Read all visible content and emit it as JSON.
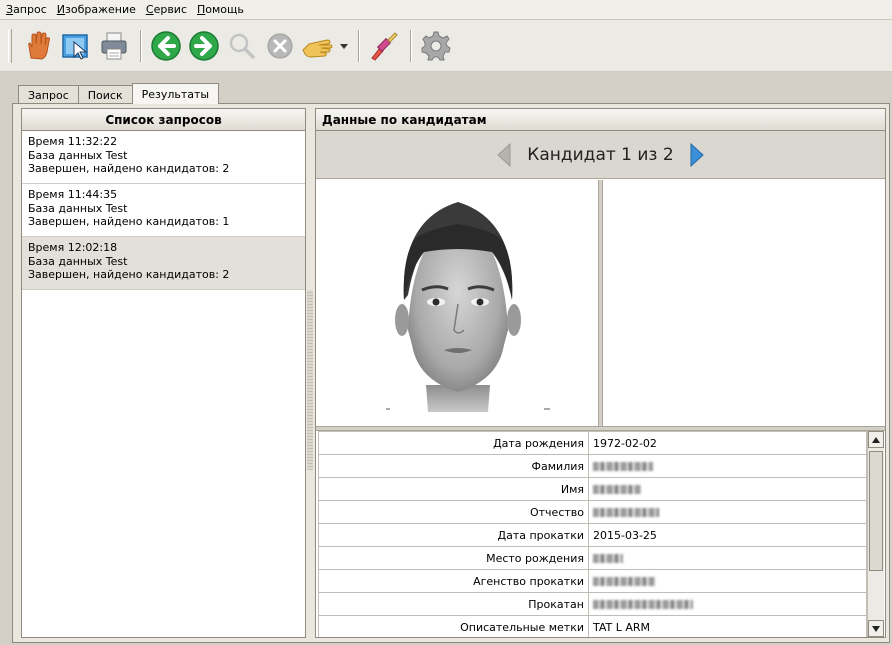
{
  "menu": [
    {
      "hotkey": "З",
      "rest": "апрос"
    },
    {
      "hotkey": "И",
      "rest": "зображение"
    },
    {
      "hotkey": "С",
      "rest": "ервис"
    },
    {
      "hotkey": "П",
      "rest": "омощь"
    }
  ],
  "toolbar": {
    "icons": [
      "hand-icon",
      "select-region-icon",
      "printer-icon",
      "back-icon",
      "forward-icon",
      "zoom-icon",
      "cancel-icon",
      "pointing-hand-icon",
      "dropdown-arrow-icon",
      "brush-icon",
      "settings-icon"
    ]
  },
  "tabs": [
    {
      "label": "Запрос",
      "active": false
    },
    {
      "label": "Поиск",
      "active": false
    },
    {
      "label": "Результаты",
      "active": true
    }
  ],
  "requests_panel": {
    "title": "Список запросов",
    "items": [
      {
        "time": "Время 11:32:22",
        "db": "База данных Test",
        "status": "Завершен, найдено кандидатов: 2"
      },
      {
        "time": "Время 11:44:35",
        "db": "База данных Test",
        "status": "Завершен, найдено кандидатов: 1"
      },
      {
        "time": "Время 12:02:18",
        "db": "База данных Test",
        "status": "Завершен, найдено кандидатов: 2",
        "selected": true
      }
    ]
  },
  "candidates_panel": {
    "title": "Данные по кандидатам",
    "nav_label": "Кандидат 1 из 2",
    "fields": [
      {
        "label": "Дата рождения",
        "value": "1972-02-02"
      },
      {
        "label": "Фамилия",
        "value": ""
      },
      {
        "label": "Имя",
        "value": ""
      },
      {
        "label": "Отчество",
        "value": ""
      },
      {
        "label": "Дата прокатки",
        "value": "2015-03-25"
      },
      {
        "label": "Место рождения",
        "value": ""
      },
      {
        "label": "Агенство прокатки",
        "value": ""
      },
      {
        "label": "Прокатан",
        "value": ""
      },
      {
        "label": "Описательные метки",
        "value": "TAT L ARM"
      }
    ]
  },
  "colors": {
    "accent_blue": "#3a8fd8",
    "nav_green": "#2fa84a"
  }
}
